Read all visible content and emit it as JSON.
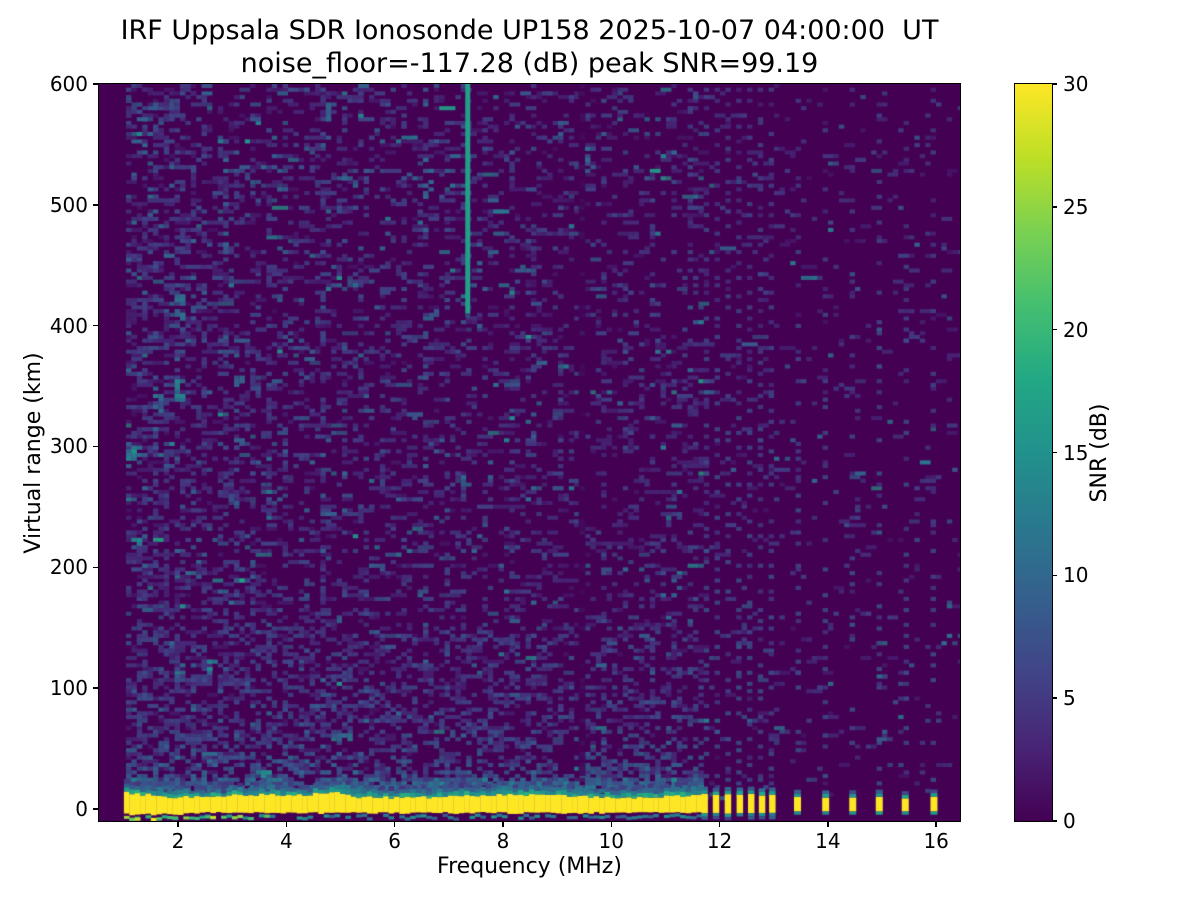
{
  "chart_data": {
    "type": "heatmap",
    "title": "IRF Uppsala SDR Ionosonde UP158 2025-10-07 04:00:00  UT",
    "subtitle": "noise_floor=-117.28 (dB) peak SNR=99.19",
    "station": "UP158",
    "timestamp_ut": "2025-10-07 04:00:00",
    "noise_floor_db": -117.28,
    "peak_snr_db": 99.19,
    "xlabel": "Frequency (MHz)",
    "ylabel": "Virtual range (km)",
    "x_range": [
      0.54,
      16.44
    ],
    "y_range": [
      -10,
      600
    ],
    "x_ticks": [
      2,
      4,
      6,
      8,
      10,
      12,
      14,
      16
    ],
    "y_ticks": [
      0,
      100,
      200,
      300,
      400,
      500,
      600
    ],
    "grid": false,
    "colorbar": {
      "label": "SNR (dB)",
      "range": [
        0,
        30
      ],
      "ticks": [
        0,
        5,
        10,
        15,
        20,
        25,
        30
      ],
      "colormap": "viridis",
      "stops": [
        {
          "t": 0.0,
          "c": "#440154"
        },
        {
          "t": 0.1,
          "c": "#482475"
        },
        {
          "t": 0.2,
          "c": "#414487"
        },
        {
          "t": 0.3,
          "c": "#355f8d"
        },
        {
          "t": 0.4,
          "c": "#2a788e"
        },
        {
          "t": 0.5,
          "c": "#21918c"
        },
        {
          "t": 0.6,
          "c": "#22a884"
        },
        {
          "t": 0.7,
          "c": "#44bf70"
        },
        {
          "t": 0.8,
          "c": "#7ad151"
        },
        {
          "t": 0.9,
          "c": "#bddf26"
        },
        {
          "t": 1.0,
          "c": "#fde725"
        }
      ]
    },
    "features": {
      "noise_seed": 987654321,
      "data_start_mhz": 1.0,
      "ground_echo_band": {
        "range_km": 0,
        "snr_db": 30,
        "freq_start_mhz": 1.0,
        "freq_end_mhz": 11.62
      },
      "pulsed_stripes_mhz": [
        11.72,
        11.93,
        12.15,
        12.37,
        12.58,
        12.78,
        12.97
      ],
      "isolated_stripes_mhz": [
        13.43,
        13.95,
        14.45,
        14.94,
        15.42,
        15.95
      ],
      "rfi_line": {
        "freq_mhz": 7.35,
        "km_from": 410,
        "km_to": 600,
        "snr_db": 17
      },
      "quiet_column_mhz": 9.45,
      "noise_streak_columns": [
        {
          "f": 1.35,
          "s": 0.5
        },
        {
          "f": 1.55,
          "s": 0.6
        },
        {
          "f": 1.75,
          "s": 0.8
        },
        {
          "f": 1.98,
          "s": 1.0
        },
        {
          "f": 2.2,
          "s": 0.6
        },
        {
          "f": 2.45,
          "s": 0.7
        },
        {
          "f": 2.8,
          "s": 0.9
        },
        {
          "f": 3.05,
          "s": 0.7
        },
        {
          "f": 3.35,
          "s": 0.5
        },
        {
          "f": 3.65,
          "s": 0.6
        },
        {
          "f": 3.95,
          "s": 0.5
        },
        {
          "f": 4.3,
          "s": 0.4
        },
        {
          "f": 4.65,
          "s": 0.9
        },
        {
          "f": 5.0,
          "s": 0.5
        },
        {
          "f": 5.35,
          "s": 0.4
        },
        {
          "f": 5.7,
          "s": 0.45
        },
        {
          "f": 6.1,
          "s": 0.4
        },
        {
          "f": 6.5,
          "s": 0.75
        },
        {
          "f": 6.9,
          "s": 0.5
        },
        {
          "f": 7.2,
          "s": 0.4
        },
        {
          "f": 7.6,
          "s": 0.35
        },
        {
          "f": 8.1,
          "s": 0.5
        },
        {
          "f": 8.55,
          "s": 0.4
        },
        {
          "f": 9.0,
          "s": 0.35
        },
        {
          "f": 9.8,
          "s": 0.3
        },
        {
          "f": 10.25,
          "s": 0.35
        },
        {
          "f": 10.7,
          "s": 0.3
        },
        {
          "f": 11.1,
          "s": 0.3
        },
        {
          "f": 11.4,
          "s": 0.3
        }
      ],
      "bright_patches": [
        {
          "f": 1.12,
          "km": 297,
          "w": 14,
          "h": 12,
          "snr": 13,
          "n": 9
        },
        {
          "f": 1.18,
          "km": 222,
          "w": 10,
          "h": 8,
          "snr": 12,
          "n": 6
        },
        {
          "f": 2.0,
          "km": 412,
          "w": 7,
          "h": 34,
          "snr": 11,
          "n": 12
        },
        {
          "f": 1.98,
          "km": 345,
          "w": 8,
          "h": 26,
          "snr": 12,
          "n": 10
        },
        {
          "f": 1.62,
          "km": 338,
          "w": 8,
          "h": 20,
          "snr": 10,
          "n": 7
        },
        {
          "f": 2.6,
          "km": 120,
          "w": 9,
          "h": 16,
          "snr": 12,
          "n": 7
        },
        {
          "f": 3.1,
          "km": 357,
          "w": 7,
          "h": 16,
          "snr": 10,
          "n": 6
        },
        {
          "f": 2.85,
          "km": 470,
          "w": 7,
          "h": 20,
          "snr": 9,
          "n": 6
        },
        {
          "f": 4.75,
          "km": 580,
          "w": 6,
          "h": 22,
          "snr": 10,
          "n": 7
        },
        {
          "f": 6.55,
          "km": 520,
          "w": 6,
          "h": 26,
          "snr": 10,
          "n": 8
        },
        {
          "f": 3.55,
          "km": 30,
          "w": 20,
          "h": 10,
          "snr": 13,
          "n": 10
        },
        {
          "f": 5.05,
          "km": 62,
          "w": 12,
          "h": 8,
          "snr": 10,
          "n": 6
        },
        {
          "f": 9.55,
          "km": 540,
          "w": 6,
          "h": 30,
          "snr": 9,
          "n": 8
        }
      ]
    }
  }
}
